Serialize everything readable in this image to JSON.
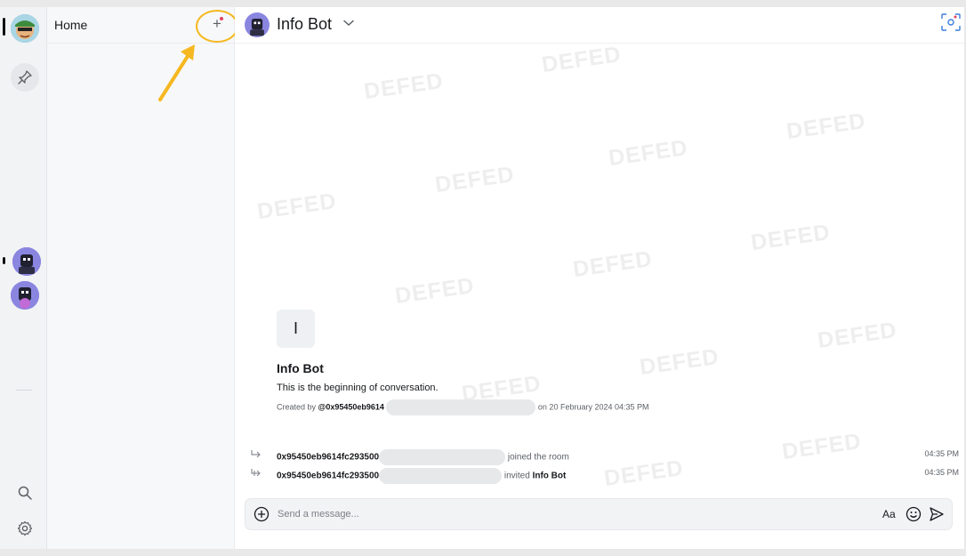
{
  "rail": {
    "spaces": [
      {
        "name": "user-avatar"
      },
      {
        "name": "bot-avatar"
      },
      {
        "name": "bot-avatar-2"
      }
    ]
  },
  "roomlist": {
    "title": "Home",
    "add_icon": "plus-icon",
    "highlight_color": "#f5b820"
  },
  "main": {
    "room_title": "Info Bot",
    "watermark_text": "DEFED",
    "intro": {
      "avatar_letter": "I",
      "name": "Info Bot",
      "subtitle": "This is the beginning of conversation.",
      "created_prefix": "Created by",
      "created_by": "@0x95450eb9614",
      "created_suffix": "on 20 February 2024 04:35 PM"
    },
    "events": [
      {
        "user": "0x95450eb9614fc293500",
        "action": "joined the room",
        "target": "",
        "time": "04:35 PM"
      },
      {
        "user": "0x95450eb9614fc293500",
        "action": "invited",
        "target": "Info Bot",
        "time": "04:35 PM"
      }
    ],
    "composer": {
      "placeholder": "Send a message...",
      "format_label": "Aa"
    }
  }
}
